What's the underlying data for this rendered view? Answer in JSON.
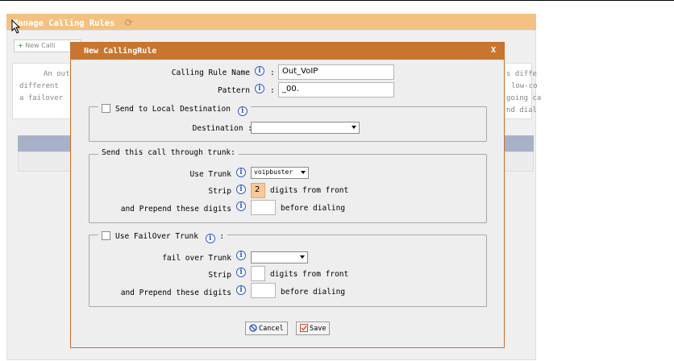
{
  "background": {
    "title": "Manage Calling Rules",
    "new_button_label": "New Calli",
    "desc_left": [
      "An outgo",
      "different",
      "a failover"
    ],
    "desc_right": [
      "s diffe",
      "low-co",
      "going ca",
      "nd dial"
    ]
  },
  "modal": {
    "title": "New CallingRule",
    "close_label": "X",
    "rule_name_label": "Calling Rule Name",
    "rule_name_value": "Out_VoIP",
    "pattern_label": "Pattern",
    "pattern_value": "_00.",
    "local_dest_legend": "Send to Local Destination",
    "destination_label": "Destination :",
    "destination_value": "",
    "trunk_legend": "Send this call through trunk:",
    "use_trunk_label": "Use Trunk",
    "use_trunk_value": "voipbuster",
    "strip_label": "Strip",
    "strip_value": "2",
    "digits_from_front": "digits from front",
    "prepend_label": "and Prepend these digits",
    "prepend_value": "",
    "before_dialing": "before dialing",
    "failover_legend": "Use FailOver Trunk",
    "failover_colon": ":",
    "failover_trunk_label": "fail over Trunk",
    "failover_trunk_value": "",
    "failover_strip_label": "Strip",
    "failover_strip_value": "",
    "failover_digits_from_front": "digits from front",
    "failover_prepend_label": "and Prepend these digits",
    "failover_prepend_value": "",
    "failover_before_dialing": "before dialing",
    "cancel_label": "Cancel",
    "save_label": "Save"
  },
  "colors": {
    "modal_header": "#c8762f",
    "bg_titlebar": "#f3c283",
    "table_header": "#a7b2c8",
    "info_icon": "#2f5bd0",
    "strip_highlight": "#f6c89a"
  }
}
